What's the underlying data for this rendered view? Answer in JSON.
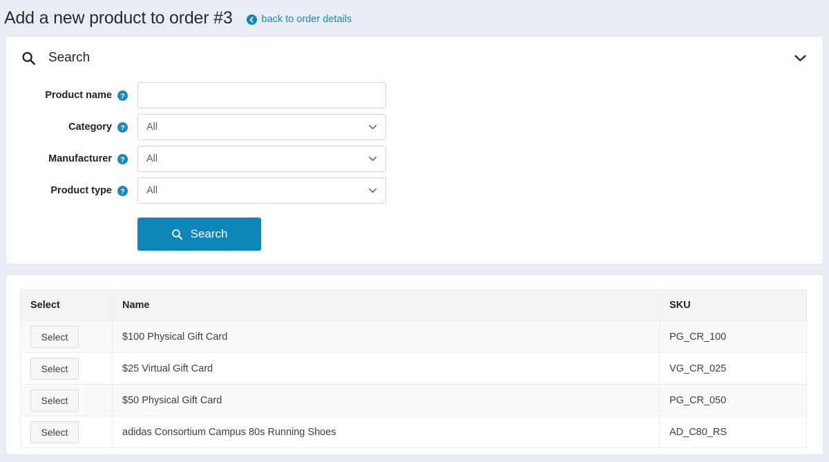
{
  "header": {
    "title": "Add a new product to order #3",
    "back_link": {
      "label": "back to order details",
      "icon": "circle-back-arrow-icon"
    }
  },
  "search_panel": {
    "title": "Search",
    "title_icon": "magnifier-icon",
    "collapse_icon": "chevron-down-icon",
    "fields": [
      {
        "label": "Product name",
        "help_icon": "question-circle-icon",
        "type": "text",
        "value": "",
        "placeholder": ""
      },
      {
        "label": "Category",
        "help_icon": "question-circle-icon",
        "type": "select",
        "value": "All"
      },
      {
        "label": "Manufacturer",
        "help_icon": "question-circle-icon",
        "type": "select",
        "value": "All"
      },
      {
        "label": "Product type",
        "help_icon": "question-circle-icon",
        "type": "select",
        "value": "All"
      }
    ],
    "search_button": {
      "label": "Search",
      "icon": "magnifier-icon"
    }
  },
  "results": {
    "columns": [
      "Select",
      "Name",
      "SKU"
    ],
    "row_button_label": "Select",
    "rows": [
      {
        "name": "$100 Physical Gift Card",
        "sku": "PG_CR_100"
      },
      {
        "name": "$25 Virtual Gift Card",
        "sku": "VG_CR_025"
      },
      {
        "name": "$50 Physical Gift Card",
        "sku": "PG_CR_050"
      },
      {
        "name": "adidas Consortium Campus 80s Running Shoes",
        "sku": "AD_C80_RS"
      }
    ]
  },
  "colors": {
    "page_background": "#e8ecf4",
    "accent_blue": "#0f86b9",
    "link_blue": "#1b87c4",
    "header_grey": "#f4f4f5",
    "stripe_grey": "#f9f9fa"
  }
}
